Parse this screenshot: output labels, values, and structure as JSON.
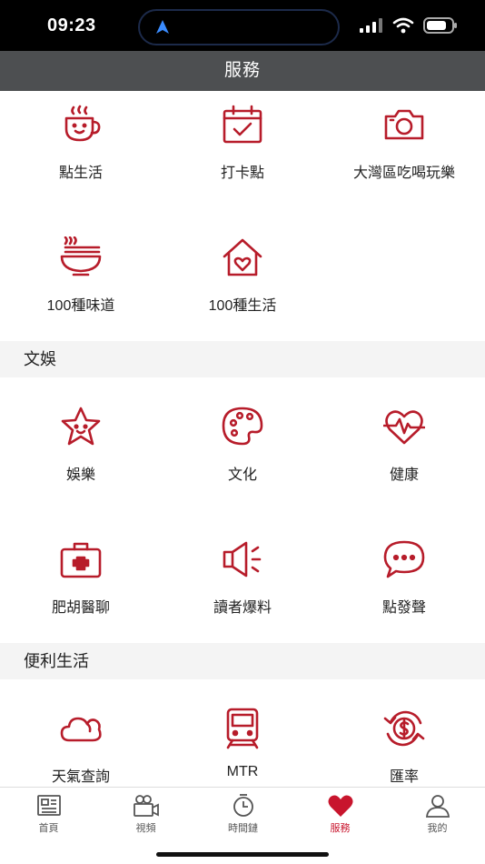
{
  "status_bar": {
    "time": "09:23"
  },
  "nav": {
    "title": "服務"
  },
  "colors": {
    "accent": "#b71c2a",
    "nav_bg": "#4d4f51",
    "section_bg": "#f4f4f4"
  },
  "grid1": [
    {
      "label": "點生活",
      "icon": "coffee-cup-icon"
    },
    {
      "label": "打卡點",
      "icon": "calendar-check-icon"
    },
    {
      "label": "大灣區吃喝玩樂",
      "icon": "camera-icon"
    },
    {
      "label": "100種味道",
      "icon": "noodle-bowl-icon"
    },
    {
      "label": "100種生活",
      "icon": "house-heart-icon"
    }
  ],
  "sections": {
    "entertainment": "文娛",
    "convenience": "便利生活"
  },
  "grid2": [
    {
      "label": "娛樂",
      "icon": "star-face-icon"
    },
    {
      "label": "文化",
      "icon": "palette-icon"
    },
    {
      "label": "健康",
      "icon": "heartbeat-icon"
    },
    {
      "label": "肥胡醫聊",
      "icon": "medical-kit-icon"
    },
    {
      "label": "讀者爆料",
      "icon": "megaphone-icon"
    },
    {
      "label": "點發聲",
      "icon": "chat-bubble-icon"
    }
  ],
  "grid3": [
    {
      "label": "天氣查詢",
      "icon": "cloud-icon"
    },
    {
      "label": "MTR",
      "icon": "train-icon"
    },
    {
      "label": "匯率",
      "icon": "currency-exchange-icon"
    }
  ],
  "tabs": [
    {
      "label": "首頁",
      "icon": "newspaper-icon"
    },
    {
      "label": "視頻",
      "icon": "video-camera-icon"
    },
    {
      "label": "時間鏈",
      "icon": "clock-icon"
    },
    {
      "label": "服務",
      "icon": "heart-icon",
      "active": true
    },
    {
      "label": "我的",
      "icon": "user-icon"
    }
  ]
}
